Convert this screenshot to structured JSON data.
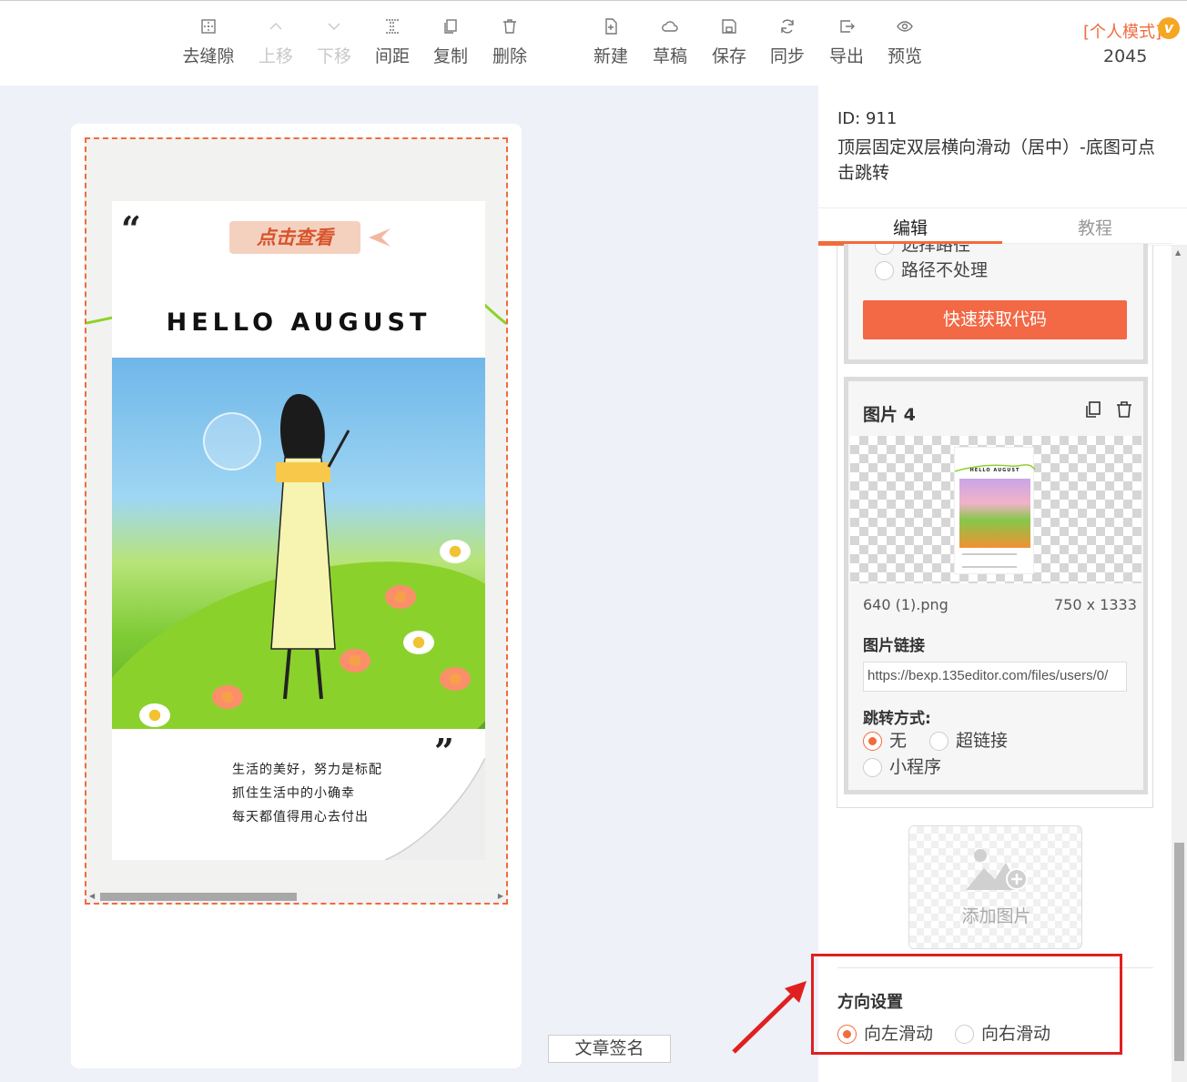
{
  "toolbar": {
    "items": [
      {
        "label": "去缝隙",
        "icon": "grid-gap-icon",
        "disabled": false
      },
      {
        "label": "上移",
        "icon": "chevron-up-icon",
        "disabled": true
      },
      {
        "label": "下移",
        "icon": "chevron-down-icon",
        "disabled": true
      },
      {
        "label": "间距",
        "icon": "spacing-icon",
        "disabled": false
      },
      {
        "label": "复制",
        "icon": "copy-icon",
        "disabled": false
      },
      {
        "label": "删除",
        "icon": "trash-icon",
        "disabled": false
      },
      {
        "label": "新建",
        "icon": "new-file-icon",
        "disabled": false
      },
      {
        "label": "草稿",
        "icon": "cloud-icon",
        "disabled": false
      },
      {
        "label": "保存",
        "icon": "save-icon",
        "disabled": false
      },
      {
        "label": "同步",
        "icon": "sync-icon",
        "disabled": false
      },
      {
        "label": "导出",
        "icon": "export-icon",
        "disabled": false
      },
      {
        "label": "预览",
        "icon": "eye-icon",
        "disabled": false
      }
    ],
    "mode_label": "[个人模式]",
    "vip_badge": "v",
    "count": "2045"
  },
  "preview": {
    "tag_button": "点击查看",
    "heading": "HELLO AUGUST",
    "lines": [
      "生活的美好，努力是标配",
      "抓住生活中的小确幸",
      "每天都值得用心去付出"
    ]
  },
  "signature_button": "文章签名",
  "panel": {
    "id_text": "ID: 911",
    "title": "顶层固定双层横向滑动（居中）-底图可点击跳转",
    "tabs": [
      {
        "label": "编辑",
        "active": true
      },
      {
        "label": "教程",
        "active": false
      }
    ],
    "path_options": [
      {
        "label": "选择路径",
        "selected": false
      },
      {
        "label": "路径不处理",
        "selected": false
      }
    ],
    "get_code_button": "快速获取代码",
    "image_item": {
      "title": "图片 4",
      "filename": "640 (1).png",
      "dimensions": "750 x 1333",
      "link_label": "图片链接",
      "link_value": "https://bexp.135editor.com/files/users/0/",
      "jump_label": "跳转方式:",
      "jump_options": [
        {
          "label": "无",
          "selected": true
        },
        {
          "label": "超链接",
          "selected": false
        },
        {
          "label": "小程序",
          "selected": false
        }
      ]
    },
    "add_image_label": "添加图片",
    "direction": {
      "title": "方向设置",
      "options": [
        {
          "label": "向左滑动",
          "selected": true
        },
        {
          "label": "向右滑动",
          "selected": false
        }
      ]
    }
  },
  "colors": {
    "accent": "#f26b3a",
    "button": "#f36845",
    "highlight": "#e02020"
  }
}
